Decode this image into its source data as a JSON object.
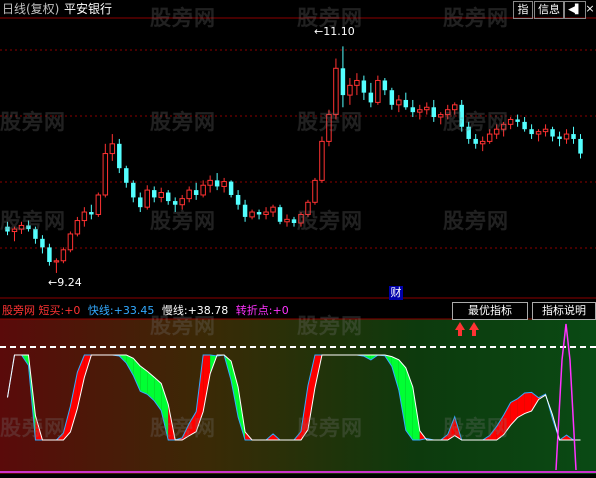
{
  "header": {
    "period": "日线(复权)",
    "stock_name": "平安银行",
    "period_color": "#c0c0c0",
    "name_color": "#ffffff"
  },
  "toolbar": {
    "btn_indicator": "指",
    "btn_info": "信息",
    "btn_arrow": "◀▌",
    "btn_close": "×"
  },
  "price_pane": {
    "high_label": "11.10",
    "low_label": "9.24",
    "finance_marker": "财",
    "up_color": "#ff3232",
    "down_color": "#54ffff",
    "grid_color": "#8b0000"
  },
  "indicator_pane": {
    "name": "股旁网 短买",
    "name_value": ":+0",
    "fast_label": "快线:",
    "fast_value": "+33.45",
    "slow_label": "慢线:",
    "slow_value": "+38.78",
    "turn_label": "转折点:",
    "turn_value": "+0",
    "btn_best": "最优指标",
    "btn_desc": "指标说明",
    "fast_color": "#33aaff",
    "slow_color": "#ffffff",
    "turn_color": "#ff33ff",
    "name_color": "#ff3333",
    "rise_color": "#ff0000",
    "fall_color": "#00ff33"
  },
  "watermark": "股旁网",
  "chart_data": {
    "type": "candlestick",
    "candles": [
      [
        9.62,
        9.66,
        9.55,
        9.58
      ],
      [
        9.58,
        9.62,
        9.5,
        9.6
      ],
      [
        9.6,
        9.66,
        9.56,
        9.63
      ],
      [
        9.63,
        9.67,
        9.58,
        9.6
      ],
      [
        9.6,
        9.62,
        9.48,
        9.52
      ],
      [
        9.52,
        9.55,
        9.4,
        9.45
      ],
      [
        9.45,
        9.48,
        9.3,
        9.33
      ],
      [
        9.33,
        9.36,
        9.24,
        9.34
      ],
      [
        9.34,
        9.45,
        9.32,
        9.43
      ],
      [
        9.43,
        9.58,
        9.41,
        9.56
      ],
      [
        9.56,
        9.7,
        9.54,
        9.67
      ],
      [
        9.67,
        9.78,
        9.62,
        9.74
      ],
      [
        9.74,
        9.8,
        9.68,
        9.72
      ],
      [
        9.72,
        9.9,
        9.7,
        9.88
      ],
      [
        9.88,
        10.3,
        9.86,
        10.22
      ],
      [
        10.22,
        10.38,
        10.16,
        10.3
      ],
      [
        10.3,
        10.34,
        10.06,
        10.1
      ],
      [
        10.1,
        10.12,
        9.94,
        9.98
      ],
      [
        9.98,
        10.0,
        9.82,
        9.86
      ],
      [
        9.86,
        9.9,
        9.74,
        9.78
      ],
      [
        9.78,
        9.96,
        9.76,
        9.92
      ],
      [
        9.92,
        9.95,
        9.82,
        9.86
      ],
      [
        9.86,
        9.94,
        9.82,
        9.9
      ],
      [
        9.9,
        9.92,
        9.8,
        9.83
      ],
      [
        9.83,
        9.86,
        9.74,
        9.8
      ],
      [
        9.8,
        9.88,
        9.76,
        9.85
      ],
      [
        9.85,
        9.95,
        9.82,
        9.92
      ],
      [
        9.92,
        9.98,
        9.84,
        9.88
      ],
      [
        9.88,
        10.0,
        9.86,
        9.96
      ],
      [
        9.96,
        10.04,
        9.9,
        10.0
      ],
      [
        10.0,
        10.06,
        9.92,
        9.95
      ],
      [
        9.95,
        10.02,
        9.9,
        9.99
      ],
      [
        9.99,
        10.0,
        9.86,
        9.88
      ],
      [
        9.88,
        9.92,
        9.76,
        9.8
      ],
      [
        9.8,
        9.84,
        9.66,
        9.7
      ],
      [
        9.7,
        9.76,
        9.68,
        9.74
      ],
      [
        9.74,
        9.76,
        9.68,
        9.72
      ],
      [
        9.72,
        9.78,
        9.68,
        9.74
      ],
      [
        9.74,
        9.8,
        9.7,
        9.78
      ],
      [
        9.78,
        9.8,
        9.64,
        9.66
      ],
      [
        9.66,
        9.72,
        9.62,
        9.68
      ],
      [
        9.68,
        9.7,
        9.62,
        9.65
      ],
      [
        9.65,
        9.74,
        9.62,
        9.72
      ],
      [
        9.72,
        9.84,
        9.7,
        9.82
      ],
      [
        9.82,
        10.02,
        9.8,
        10.0
      ],
      [
        10.0,
        10.36,
        9.98,
        10.32
      ],
      [
        10.32,
        10.58,
        10.28,
        10.54
      ],
      [
        10.54,
        11.0,
        10.5,
        10.92
      ],
      [
        10.92,
        11.1,
        10.6,
        10.7
      ],
      [
        10.7,
        10.84,
        10.62,
        10.78
      ],
      [
        10.78,
        10.88,
        10.7,
        10.82
      ],
      [
        10.82,
        10.86,
        10.66,
        10.72
      ],
      [
        10.72,
        10.8,
        10.6,
        10.64
      ],
      [
        10.64,
        10.86,
        10.62,
        10.82
      ],
      [
        10.82,
        10.84,
        10.7,
        10.74
      ],
      [
        10.74,
        10.76,
        10.58,
        10.62
      ],
      [
        10.62,
        10.7,
        10.56,
        10.66
      ],
      [
        10.66,
        10.72,
        10.58,
        10.6
      ],
      [
        10.6,
        10.66,
        10.52,
        10.56
      ],
      [
        10.56,
        10.62,
        10.5,
        10.58
      ],
      [
        10.58,
        10.64,
        10.54,
        10.6
      ],
      [
        10.6,
        10.66,
        10.48,
        10.52
      ],
      [
        10.52,
        10.56,
        10.46,
        10.54
      ],
      [
        10.54,
        10.62,
        10.5,
        10.58
      ],
      [
        10.58,
        10.64,
        10.54,
        10.62
      ],
      [
        10.62,
        10.66,
        10.4,
        10.44
      ],
      [
        10.44,
        10.48,
        10.3,
        10.34
      ],
      [
        10.34,
        10.38,
        10.26,
        10.3
      ],
      [
        10.3,
        10.36,
        10.24,
        10.32
      ],
      [
        10.32,
        10.42,
        10.3,
        10.38
      ],
      [
        10.38,
        10.46,
        10.34,
        10.42
      ],
      [
        10.42,
        10.48,
        10.36,
        10.46
      ],
      [
        10.46,
        10.52,
        10.42,
        10.5
      ],
      [
        10.5,
        10.54,
        10.44,
        10.48
      ],
      [
        10.48,
        10.52,
        10.4,
        10.42
      ],
      [
        10.42,
        10.46,
        10.34,
        10.38
      ],
      [
        10.38,
        10.42,
        10.32,
        10.4
      ],
      [
        10.4,
        10.46,
        10.36,
        10.42
      ],
      [
        10.42,
        10.44,
        10.32,
        10.36
      ],
      [
        10.36,
        10.4,
        10.28,
        10.34
      ],
      [
        10.34,
        10.42,
        10.3,
        10.38
      ],
      [
        10.38,
        10.44,
        10.3,
        10.34
      ],
      [
        10.34,
        10.38,
        10.18,
        10.22
      ]
    ],
    "high_label_value": 11.1,
    "low_label_value": 9.24,
    "ylim": [
      9.1,
      11.3
    ]
  }
}
